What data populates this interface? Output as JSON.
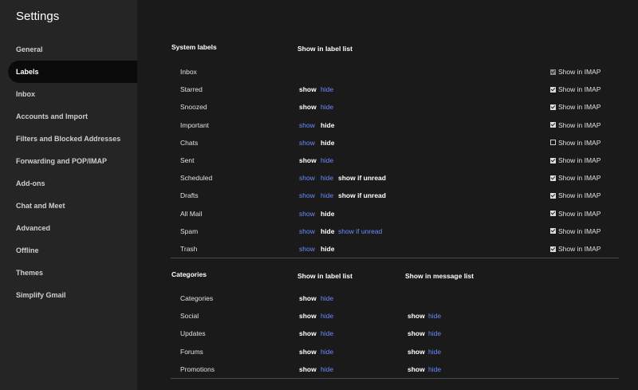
{
  "sidebar": {
    "title": "Settings",
    "items": [
      {
        "label": "General"
      },
      {
        "label": "Labels",
        "active": true
      },
      {
        "label": "Inbox"
      },
      {
        "label": "Accounts and Import"
      },
      {
        "label": "Filters and Blocked Addresses"
      },
      {
        "label": "Forwarding and POP/IMAP"
      },
      {
        "label": "Add-ons"
      },
      {
        "label": "Chat and Meet"
      },
      {
        "label": "Advanced"
      },
      {
        "label": "Offline"
      },
      {
        "label": "Themes"
      },
      {
        "label": "Simplify Gmail"
      }
    ]
  },
  "system": {
    "header": "System labels",
    "col_label_list": "Show in label list",
    "rows": [
      {
        "name": "Inbox",
        "imap": {
          "label": "Show in IMAP",
          "checked": true,
          "disabled": true
        }
      },
      {
        "name": "Starred",
        "show": "show",
        "hide": "hide",
        "selected": "show",
        "imap": {
          "label": "Show in IMAP",
          "checked": true
        }
      },
      {
        "name": "Snoozed",
        "show": "show",
        "hide": "hide",
        "selected": "show",
        "imap": {
          "label": "Show in IMAP",
          "checked": true
        }
      },
      {
        "name": "Important",
        "show": "show",
        "hide": "hide",
        "selected": "hide",
        "imap": {
          "label": "Show in IMAP",
          "checked": true
        }
      },
      {
        "name": "Chats",
        "show": "show",
        "hide": "hide",
        "selected": "hide",
        "imap": {
          "label": "Show in IMAP",
          "checked": false
        }
      },
      {
        "name": "Sent",
        "show": "show",
        "hide": "hide",
        "selected": "show",
        "imap": {
          "label": "Show in IMAP",
          "checked": true
        }
      },
      {
        "name": "Scheduled",
        "show": "show",
        "hide": "hide",
        "unread": "show if unread",
        "selected": "unread",
        "imap": {
          "label": "Show in IMAP",
          "checked": true
        }
      },
      {
        "name": "Drafts",
        "show": "show",
        "hide": "hide",
        "unread": "show if unread",
        "selected": "unread",
        "imap": {
          "label": "Show in IMAP",
          "checked": true
        }
      },
      {
        "name": "All Mail",
        "show": "show",
        "hide": "hide",
        "selected": "hide",
        "imap": {
          "label": "Show in IMAP",
          "checked": true
        }
      },
      {
        "name": "Spam",
        "show": "show",
        "hide": "hide",
        "unread": "show if unread",
        "selected": "hide",
        "imap": {
          "label": "Show in IMAP",
          "checked": true
        }
      },
      {
        "name": "Trash",
        "show": "show",
        "hide": "hide",
        "selected": "hide",
        "imap": {
          "label": "Show in IMAP",
          "checked": true
        }
      }
    ]
  },
  "categories": {
    "header": "Categories",
    "col_label_list": "Show in label list",
    "col_message_list": "Show in message list",
    "rows": [
      {
        "name": "Categories",
        "show": "show",
        "hide": "hide",
        "selected": "show"
      },
      {
        "name": "Social",
        "show": "show",
        "hide": "hide",
        "selected": "show",
        "msg_show": "show",
        "msg_hide": "hide",
        "msg_selected": "show"
      },
      {
        "name": "Updates",
        "show": "show",
        "hide": "hide",
        "selected": "show",
        "msg_show": "show",
        "msg_hide": "hide",
        "msg_selected": "show"
      },
      {
        "name": "Forums",
        "show": "show",
        "hide": "hide",
        "selected": "show",
        "msg_show": "show",
        "msg_hide": "hide",
        "msg_selected": "show"
      },
      {
        "name": "Promotions",
        "show": "show",
        "hide": "hide",
        "selected": "show",
        "msg_show": "show",
        "msg_hide": "hide",
        "msg_selected": "show"
      }
    ]
  }
}
